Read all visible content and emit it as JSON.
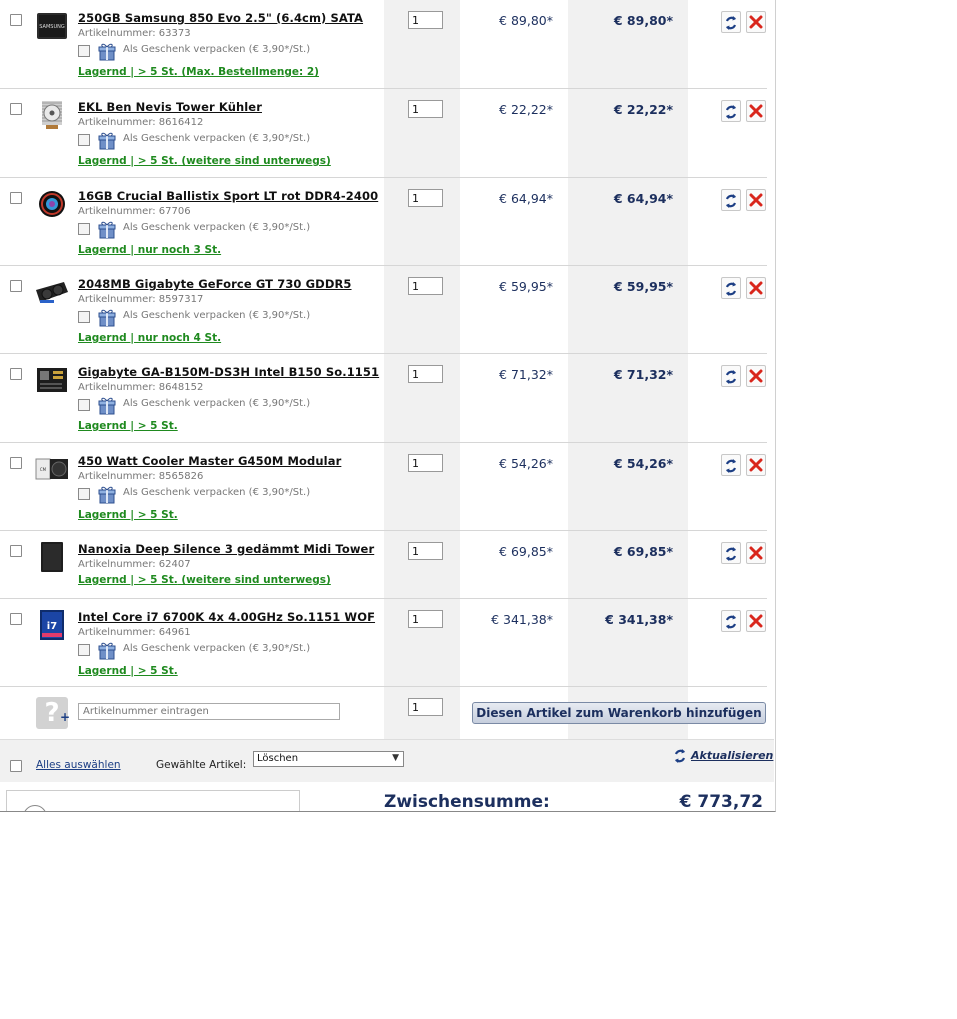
{
  "currency_symbol": "€",
  "items": [
    {
      "title": "250GB Samsung 850 Evo 2.5\" (6.4cm) SATA",
      "artnr": "Artikelnummer: 63373",
      "gift": true,
      "stock": "Lagernd | > 5 St.",
      "stock_extra": " (Max. Bestellmenge: 2)",
      "qty": "1",
      "price": "€ 89,80*",
      "total": "€ 89,80*",
      "thumb": "ssd"
    },
    {
      "title": "EKL Ben Nevis Tower Kühler",
      "artnr": "Artikelnummer: 8616412",
      "gift": true,
      "stock": "Lagernd | > 5 St.",
      "stock_extra": " (weitere sind unterwegs)",
      "qty": "1",
      "price": "€ 22,22*",
      "total": "€ 22,22*",
      "thumb": "cooler"
    },
    {
      "title": "16GB Crucial Ballistix Sport LT rot DDR4-2400",
      "artnr": "Artikelnummer: 67706",
      "gift": true,
      "stock": "Lagernd | nur noch 3 St.",
      "stock_extra": "",
      "qty": "1",
      "price": "€ 64,94*",
      "total": "€ 64,94*",
      "thumb": "ram"
    },
    {
      "title": "2048MB Gigabyte GeForce GT 730 GDDR5",
      "artnr": "Artikelnummer: 8597317",
      "gift": true,
      "stock": "Lagernd | nur noch 4 St.",
      "stock_extra": "",
      "qty": "1",
      "price": "€ 59,95*",
      "total": "€ 59,95*",
      "thumb": "gpu"
    },
    {
      "title": "Gigabyte GA-B150M-DS3H Intel B150 So.1151",
      "artnr": "Artikelnummer: 8648152",
      "gift": true,
      "stock": "Lagernd | > 5 St.",
      "stock_extra": "",
      "qty": "1",
      "price": "€ 71,32*",
      "total": "€ 71,32*",
      "thumb": "board"
    },
    {
      "title": "450 Watt Cooler Master G450M Modular",
      "artnr": "Artikelnummer: 8565826",
      "gift": true,
      "stock": "Lagernd | > 5 St.",
      "stock_extra": "",
      "qty": "1",
      "price": "€ 54,26*",
      "total": "€ 54,26*",
      "thumb": "psu"
    },
    {
      "title": "Nanoxia Deep Silence 3 gedämmt Midi Tower",
      "artnr": "Artikelnummer: 62407",
      "gift": false,
      "stock": "Lagernd | > 5 St.",
      "stock_extra": " (weitere sind unterwegs)",
      "qty": "1",
      "price": "€ 69,85*",
      "total": "€ 69,85*",
      "thumb": "case"
    },
    {
      "title": "Intel Core i7 6700K 4x 4.00GHz So.1151 WOF",
      "artnr": "Artikelnummer: 64961",
      "gift": true,
      "stock": "Lagernd | > 5 St.",
      "stock_extra": "",
      "qty": "1",
      "price": "€ 341,38*",
      "total": "€ 341,38*",
      "thumb": "cpu"
    }
  ],
  "gift_label": "Als Geschenk verpacken (€ 3,90*/St.)",
  "add_row": {
    "placeholder": "Artikelnummer eintragen",
    "qty": "1",
    "button": "Diesen Artikel zum Warenkorb hinzufügen"
  },
  "footer": {
    "select_all": "Alles auswählen",
    "selected_label": "Gewählte Artikel:",
    "action": "Löschen",
    "update": "Aktualisieren"
  },
  "subtotal": {
    "label": "Zwischensumme:",
    "value": "€ 773,72"
  },
  "colors": {
    "brand_blue": "#1c2f5e",
    "stock_green": "#1f8a1f",
    "delete_red": "#d9261c"
  }
}
